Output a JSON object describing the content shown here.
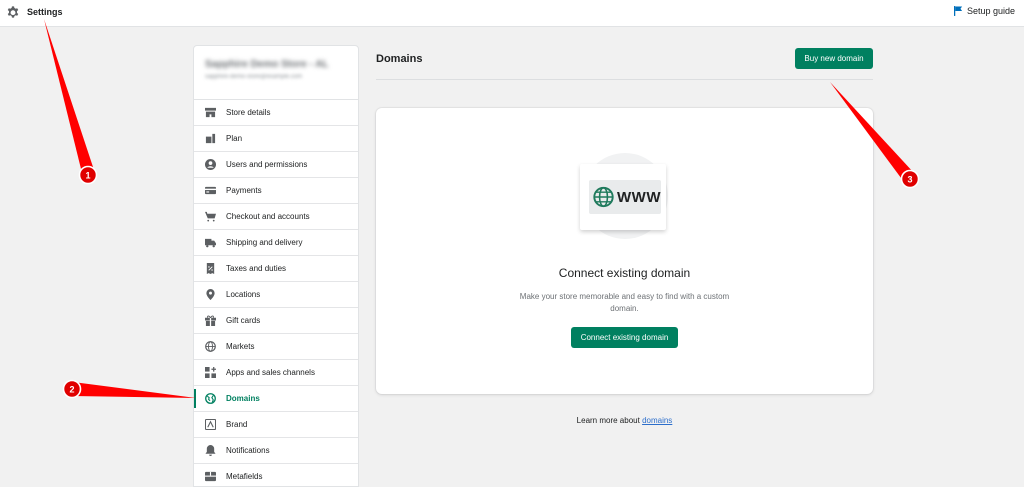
{
  "topbar": {
    "title": "Settings",
    "setup_guide": "Setup guide"
  },
  "store": {
    "name": "Sapphire Demo Store - AL",
    "email": "sapphire-demo-store@example.com"
  },
  "sidebar": {
    "items": [
      {
        "label": "Store details",
        "icon": "store-icon"
      },
      {
        "label": "Plan",
        "icon": "plan-icon"
      },
      {
        "label": "Users and permissions",
        "icon": "user-icon"
      },
      {
        "label": "Payments",
        "icon": "payments-icon"
      },
      {
        "label": "Checkout and accounts",
        "icon": "cart-icon"
      },
      {
        "label": "Shipping and delivery",
        "icon": "truck-icon"
      },
      {
        "label": "Taxes and duties",
        "icon": "tax-icon"
      },
      {
        "label": "Locations",
        "icon": "location-icon"
      },
      {
        "label": "Gift cards",
        "icon": "gift-icon"
      },
      {
        "label": "Markets",
        "icon": "globe-icon"
      },
      {
        "label": "Apps and sales channels",
        "icon": "apps-icon"
      },
      {
        "label": "Domains",
        "icon": "domains-icon",
        "active": true
      },
      {
        "label": "Brand",
        "icon": "brand-icon"
      },
      {
        "label": "Notifications",
        "icon": "bell-icon"
      },
      {
        "label": "Metafields",
        "icon": "metafields-icon"
      }
    ]
  },
  "main": {
    "title": "Domains",
    "buy_button": "Buy new domain",
    "card": {
      "illustration_text": "WWW",
      "title": "Connect existing domain",
      "description": "Make your store memorable and easy to find with a custom domain.",
      "connect_button": "Connect existing domain"
    },
    "learn_prefix": "Learn more about",
    "learn_link": "domains"
  },
  "annotations": [
    "1",
    "2",
    "3"
  ],
  "colors": {
    "primary": "#008060",
    "link": "#2c6ecb",
    "annotation": "#ff0000"
  }
}
